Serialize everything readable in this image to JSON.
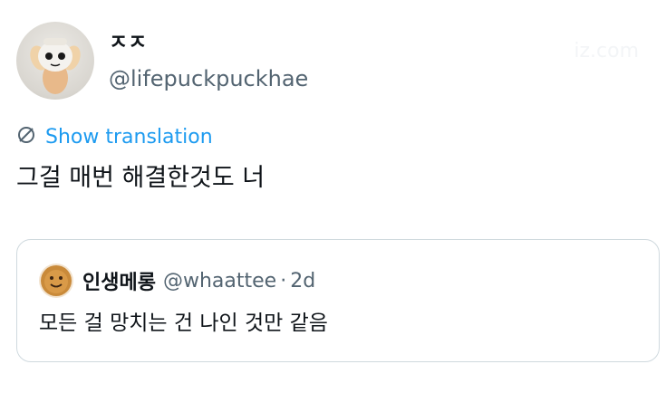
{
  "author": {
    "display_name": "ㅈㅈ",
    "handle": "@lifepuckpuckhae"
  },
  "watermark": "iz.com",
  "translation": {
    "icon": "globe-slash-icon",
    "label": "Show translation"
  },
  "tweet": {
    "text": "그걸 매번 해결한것도 너"
  },
  "quoted": {
    "display_name": "인생메롱",
    "handle": "@whaattee",
    "separator": "·",
    "time": "2d",
    "text": "모든 걸 망치는 건 나인 것만 같음"
  },
  "colors": {
    "link": "#1d9bf0",
    "secondary": "#536471",
    "border": "#cfd9de"
  }
}
